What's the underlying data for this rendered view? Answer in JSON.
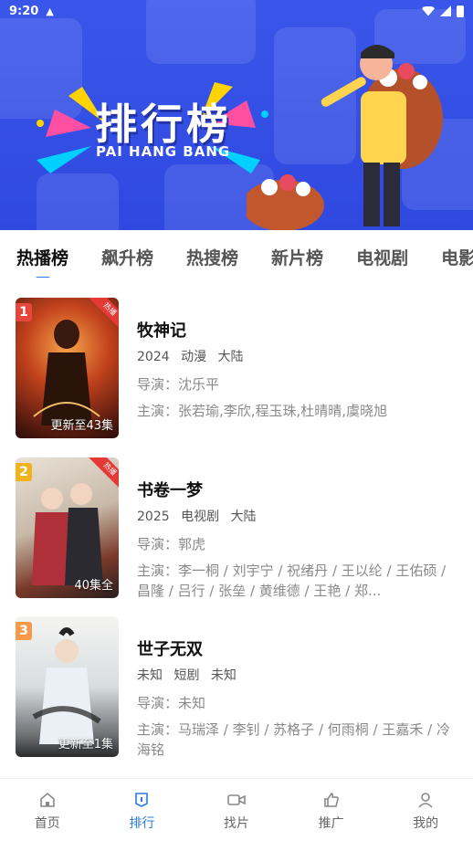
{
  "status_bar": {
    "time": "9:20",
    "notification_icon": "android-icon"
  },
  "banner": {
    "title": "排行榜",
    "subtitle": "PAI HANG BANG"
  },
  "tabs": [
    {
      "label": "热播榜",
      "active": true
    },
    {
      "label": "飙升榜",
      "active": false
    },
    {
      "label": "热搜榜",
      "active": false
    },
    {
      "label": "新片榜",
      "active": false
    },
    {
      "label": "电视剧",
      "active": false
    },
    {
      "label": "电影",
      "active": false
    }
  ],
  "items": [
    {
      "rank": "1",
      "rank_color": "#e8453c",
      "hot_label": "热播",
      "update": "更新至43集",
      "title": "牧神记",
      "year": "2024",
      "genre": "动漫",
      "region": "大陆",
      "director": "导演：沈乐平",
      "cast": "主演：张若瑜,李欣,程玉珠,杜晴晴,虞晓旭"
    },
    {
      "rank": "2",
      "rank_color": "#f2b21d",
      "hot_label": "热播",
      "update": "40集全",
      "title": "书卷一梦",
      "year": "2025",
      "genre": "电视剧",
      "region": "大陆",
      "director": "导演：郭虎",
      "cast": "主演：李一桐 / 刘宇宁 / 祝绪丹 / 王以纶 / 王佑硕 / 昌隆 / 吕行 / 张垒 / 黄维德 / 王艳 / 郑..."
    },
    {
      "rank": "3",
      "rank_color": "#f59a4a",
      "hot_label": "",
      "update": "更新至1集",
      "title": "世子无双",
      "year": "未知",
      "genre": "短剧",
      "region": "未知",
      "director": "导演：未知",
      "cast": "主演：马瑞泽 / 李钊 / 苏格子 / 何雨桐 / 王嘉禾 / 冷海铭"
    }
  ],
  "bottom_nav": [
    {
      "label": "首页",
      "icon": "home-icon",
      "active": false
    },
    {
      "label": "排行",
      "icon": "ranking-icon",
      "active": true
    },
    {
      "label": "找片",
      "icon": "video-camera-icon",
      "active": false
    },
    {
      "label": "推广",
      "icon": "thumbs-up-icon",
      "active": false
    },
    {
      "label": "我的",
      "icon": "person-icon",
      "active": false
    }
  ],
  "colors": {
    "accent": "#2a7ae2",
    "banner": "#3a56ea"
  }
}
